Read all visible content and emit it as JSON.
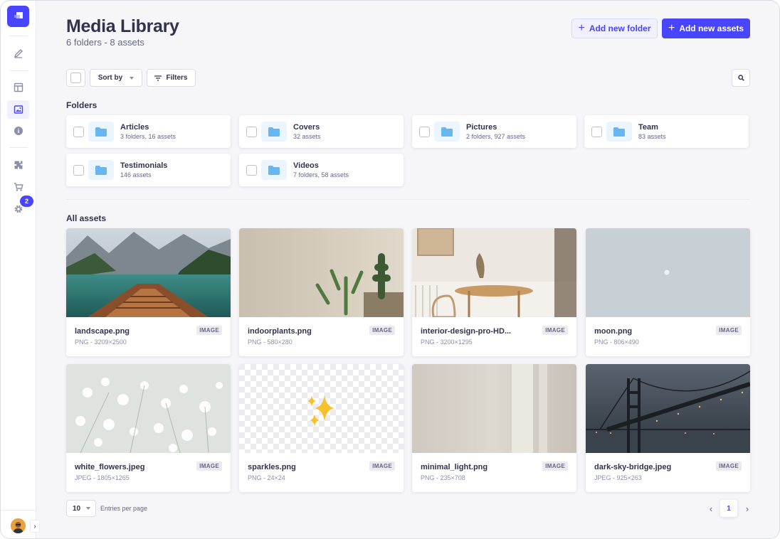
{
  "header": {
    "title": "Media Library",
    "subtitle": "6 folders - 8 assets",
    "add_folder_label": "Add new folder",
    "add_assets_label": "Add new assets"
  },
  "toolbar": {
    "sort_label": "Sort by",
    "filters_label": "Filters"
  },
  "sidebar": {
    "settings_badge": "2",
    "icons": [
      "content-manager-icon",
      "content-type-builder-icon",
      "media-library-icon",
      "info-icon",
      "plugins-icon",
      "marketplace-icon",
      "settings-icon"
    ],
    "active_icon": "media-library-icon"
  },
  "folders_title": "Folders",
  "folders": [
    {
      "name": "Articles",
      "meta": "3 folders, 16 assets"
    },
    {
      "name": "Covers",
      "meta": "32 assets"
    },
    {
      "name": "Pictures",
      "meta": "2 folders, 927 assets"
    },
    {
      "name": "Team",
      "meta": "83 assets"
    },
    {
      "name": "Testimonials",
      "meta": "146 assets"
    },
    {
      "name": "Videos",
      "meta": "7 folders, 58 assets"
    }
  ],
  "assets_title": "All assets",
  "assets": [
    {
      "name": "landscape.png",
      "meta": "PNG - 3209×2500",
      "tag": "IMAGE"
    },
    {
      "name": "indoorplants.png",
      "meta": "PNG - 580×280",
      "tag": "IMAGE"
    },
    {
      "name": "interior-design-pro-HD...",
      "meta": "PNG - 3200×1295",
      "tag": "IMAGE"
    },
    {
      "name": "moon.png",
      "meta": "PNG - 806×490",
      "tag": "IMAGE"
    },
    {
      "name": "white_flowers.jpeg",
      "meta": "JPEG - 1805×1265",
      "tag": "IMAGE"
    },
    {
      "name": "sparkles.png",
      "meta": "PNG - 24×24",
      "tag": "IMAGE"
    },
    {
      "name": "minimal_light.png",
      "meta": "PNG - 235×708",
      "tag": "IMAGE"
    },
    {
      "name": "dark-sky-bridge.jpeg",
      "meta": "JPEG - 925×263",
      "tag": "IMAGE"
    }
  ],
  "pagination": {
    "per_page": "10",
    "per_page_label": "Entries per page",
    "current_page": "1"
  },
  "colors": {
    "primary": "#4945ff",
    "folder_icon": "#66b7f1",
    "background": "#f6f6f9"
  }
}
